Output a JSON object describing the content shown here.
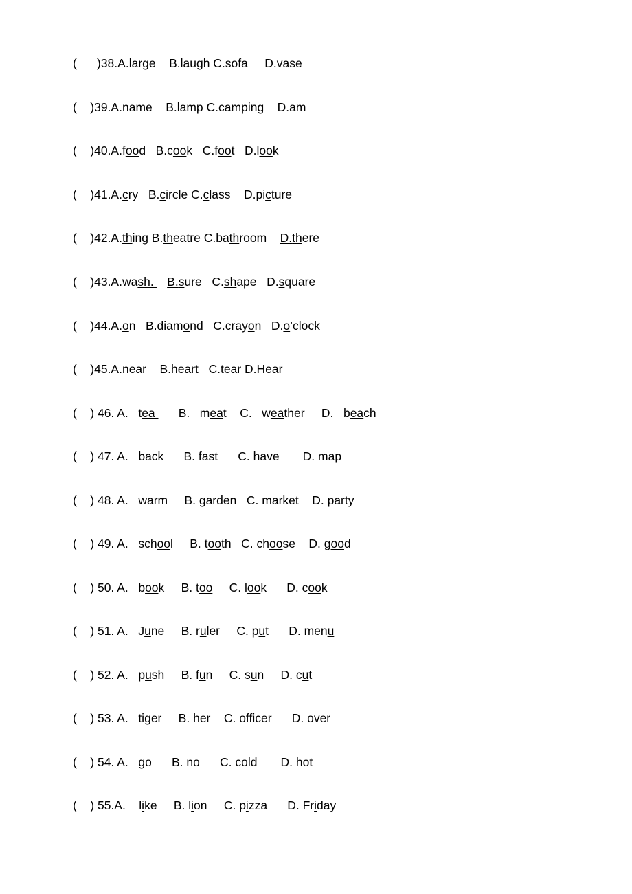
{
  "document": {
    "type": "worksheet",
    "section_title": "",
    "page_background": "#ffffff",
    "text_color": "#000000"
  },
  "questions": [
    {
      "number": "38",
      "bracket": "(",
      "bracket_close": ")",
      "gap": "      ",
      "prefix": ")38.A.",
      "separator": "compact",
      "options": [
        {
          "letter": "",
          "pre": "l",
          "mark": "ar",
          "post": "ge",
          "trail": "",
          "lead": ""
        },
        {
          "letter": "B.",
          "pre": "l",
          "mark": "au",
          "post": "gh",
          "trail": "",
          "lead": "    "
        },
        {
          "letter": "C.",
          "pre": "sof",
          "mark": "a ",
          "post": "",
          "trail": "",
          "lead": " "
        },
        {
          "letter": "D.",
          "pre": "v",
          "mark": "a",
          "post": "se",
          "trail": "",
          "lead": "    "
        }
      ]
    },
    {
      "number": "39",
      "prefix": ")39.A.",
      "options": [
        {
          "letter": "",
          "pre": "n",
          "mark": "a",
          "post": "me",
          "lead": ""
        },
        {
          "letter": "B.",
          "pre": "l",
          "mark": "a",
          "post": "mp",
          "lead": "    "
        },
        {
          "letter": "C.",
          "pre": "c",
          "mark": "a",
          "post": "mping",
          "lead": " "
        },
        {
          "letter": "D.",
          "pre": "",
          "mark": "a",
          "post": "m",
          "lead": "    "
        }
      ]
    },
    {
      "number": "40",
      "prefix": ")40.A.",
      "options": [
        {
          "letter": "",
          "pre": "f",
          "mark": "oo",
          "post": "d",
          "lead": ""
        },
        {
          "letter": "B.",
          "pre": "c",
          "mark": "oo",
          "post": "k",
          "lead": "   "
        },
        {
          "letter": "C.",
          "pre": "f",
          "mark": "oo",
          "post": "t",
          "lead": "   "
        },
        {
          "letter": "D.",
          "pre": "l",
          "mark": "oo",
          "post": "k",
          "lead": "   "
        }
      ]
    },
    {
      "number": "41",
      "prefix": ")41.A.",
      "options": [
        {
          "letter": "",
          "pre": "",
          "mark": "c",
          "post": "ry",
          "lead": ""
        },
        {
          "letter": "B.",
          "pre": "",
          "mark": "c",
          "post": "ircle",
          "lead": "   "
        },
        {
          "letter": "C.",
          "pre": "",
          "mark": "c",
          "post": "lass",
          "lead": " "
        },
        {
          "letter": "D.",
          "pre": "pi",
          "mark": "c",
          "post": "ture",
          "lead": "    "
        }
      ]
    },
    {
      "number": "42",
      "prefix": ")42.A.",
      "options": [
        {
          "letter": "",
          "pre": "",
          "mark": "th",
          "post": "ing",
          "lead": ""
        },
        {
          "letter": "B.",
          "pre": "",
          "mark": "th",
          "post": "eatre",
          "lead": " "
        },
        {
          "letter": "C.",
          "pre": "ba",
          "mark": "th",
          "post": "room",
          "lead": " "
        },
        {
          "letter": "D.",
          "pre": "",
          "mark": "th",
          "post": "ere",
          "lead": "    ",
          "letter_underlined": true
        }
      ]
    },
    {
      "number": "43",
      "prefix": ")43.A.",
      "options": [
        {
          "letter": "",
          "pre": "wa",
          "mark": "sh. ",
          "post": "",
          "lead": ""
        },
        {
          "letter": "B.",
          "pre": "",
          "mark": "s",
          "post": "ure",
          "lead": "   ",
          "letter_underlined": true
        },
        {
          "letter": "C.",
          "pre": "",
          "mark": "sh",
          "post": "ape",
          "lead": "   "
        },
        {
          "letter": "D.",
          "pre": "",
          "mark": "s",
          "post": "quare",
          "lead": "   "
        }
      ]
    },
    {
      "number": "44",
      "prefix": ")44.A.",
      "options": [
        {
          "letter": "",
          "pre": "",
          "mark": "o",
          "post": "n",
          "lead": ""
        },
        {
          "letter": "B.",
          "pre": "diam",
          "mark": "o",
          "post": "nd",
          "lead": "   "
        },
        {
          "letter": "C.",
          "pre": "cray",
          "mark": "o",
          "post": "n",
          "lead": "   "
        },
        {
          "letter": "D.",
          "pre": "",
          "mark": "o",
          "post": "’clock",
          "lead": "   "
        }
      ]
    },
    {
      "number": "45",
      "prefix": ")45.A.",
      "options": [
        {
          "letter": "",
          "pre": "n",
          "mark": "ear ",
          "post": "",
          "lead": ""
        },
        {
          "letter": "B.",
          "pre": "h",
          "mark": "ear",
          "post": "t",
          "lead": "   "
        },
        {
          "letter": "C.",
          "pre": "t",
          "mark": "ear",
          "post": "",
          "lead": "   "
        },
        {
          "letter": "D.",
          "pre": "H",
          "mark": "ear",
          "post": "",
          "lead": " "
        }
      ]
    },
    {
      "number": "46",
      "prefix": ") 46. A.",
      "separator": "spaced",
      "options": [
        {
          "letter": "",
          "pre": "t",
          "mark": "ea ",
          "post": "",
          "lead": "   "
        },
        {
          "letter": "B.",
          "pre": "m",
          "mark": "ea",
          "post": "t",
          "lead": "      ",
          "letter_gap": "   "
        },
        {
          "letter": "C.",
          "pre": "w",
          "mark": "ea",
          "post": "ther",
          "lead": "    ",
          "letter_gap": "   "
        },
        {
          "letter": "D.",
          "pre": "b",
          "mark": "ea",
          "post": "ch",
          "lead": "     ",
          "letter_gap": "   "
        }
      ]
    },
    {
      "number": "47",
      "prefix": ") 47. A.",
      "options": [
        {
          "letter": "",
          "pre": "b",
          "mark": "a",
          "post": "ck",
          "lead": "   "
        },
        {
          "letter": "B.",
          "pre": "f",
          "mark": "a",
          "post": "st",
          "lead": "      ",
          "letter_gap": " "
        },
        {
          "letter": "C.",
          "pre": "h",
          "mark": "a",
          "post": "ve",
          "lead": "      ",
          "letter_gap": " "
        },
        {
          "letter": "D.",
          "pre": "m",
          "mark": "a",
          "post": "p",
          "lead": "       ",
          "letter_gap": " "
        }
      ]
    },
    {
      "number": "48",
      "prefix": ") 48. A.",
      "options": [
        {
          "letter": "",
          "pre": "w",
          "mark": "ar",
          "post": "m",
          "lead": "   "
        },
        {
          "letter": "B.",
          "pre": "g",
          "mark": "ar",
          "post": "den",
          "lead": "     ",
          "letter_gap": " "
        },
        {
          "letter": "C.",
          "pre": "m",
          "mark": "ar",
          "post": "ket",
          "lead": "   ",
          "letter_gap": " "
        },
        {
          "letter": "D.",
          "pre": "p",
          "mark": "ar",
          "post": "ty",
          "lead": "    ",
          "letter_gap": " "
        }
      ]
    },
    {
      "number": "49",
      "prefix": ") 49. A.",
      "options": [
        {
          "letter": "",
          "pre": "sch",
          "mark": "oo",
          "post": "l",
          "lead": "   "
        },
        {
          "letter": "B.",
          "pre": "t",
          "mark": "oo",
          "post": "th",
          "lead": "     ",
          "letter_gap": " "
        },
        {
          "letter": "C.",
          "pre": "ch",
          "mark": "oo",
          "post": "se",
          "lead": "   ",
          "letter_gap": " "
        },
        {
          "letter": "D.",
          "pre": "g",
          "mark": "oo",
          "post": "d",
          "lead": "    ",
          "letter_gap": " "
        }
      ]
    },
    {
      "number": "50",
      "prefix": ") 50. A.",
      "options": [
        {
          "letter": "",
          "pre": "b",
          "mark": "oo",
          "post": "k",
          "lead": "   "
        },
        {
          "letter": "B.",
          "pre": "t",
          "mark": "oo",
          "post": "",
          "lead": "     ",
          "letter_gap": " "
        },
        {
          "letter": "C.",
          "pre": "l",
          "mark": "oo",
          "post": "k",
          "lead": "     ",
          "letter_gap": " "
        },
        {
          "letter": "D.",
          "pre": "c",
          "mark": "oo",
          "post": "k",
          "lead": "      ",
          "letter_gap": " "
        }
      ]
    },
    {
      "number": "51",
      "prefix": ") 51. A.",
      "options": [
        {
          "letter": "",
          "pre": "J",
          "mark": "u",
          "post": "ne",
          "lead": "   "
        },
        {
          "letter": "B.",
          "pre": "r",
          "mark": "u",
          "post": "ler",
          "lead": "     ",
          "letter_gap": " "
        },
        {
          "letter": "C.",
          "pre": "p",
          "mark": "u",
          "post": "t",
          "lead": "     ",
          "letter_gap": " "
        },
        {
          "letter": "D.",
          "pre": "men",
          "mark": "u",
          "post": "",
          "lead": "      ",
          "letter_gap": " "
        }
      ]
    },
    {
      "number": "52",
      "prefix": ") 52. A.",
      "options": [
        {
          "letter": "",
          "pre": "p",
          "mark": "u",
          "post": "sh",
          "lead": "   "
        },
        {
          "letter": "B.",
          "pre": "f",
          "mark": "u",
          "post": "n",
          "lead": "     ",
          "letter_gap": " "
        },
        {
          "letter": "C.",
          "pre": "s",
          "mark": "u",
          "post": "n",
          "lead": "     ",
          "letter_gap": " "
        },
        {
          "letter": "D.",
          "pre": "c",
          "mark": "u",
          "post": "t",
          "lead": "     ",
          "letter_gap": " "
        }
      ]
    },
    {
      "number": "53",
      "prefix": ") 53. A.",
      "options": [
        {
          "letter": "",
          "pre": "tig",
          "mark": "er",
          "post": "",
          "lead": "   "
        },
        {
          "letter": "B.",
          "pre": "h",
          "mark": "er",
          "post": "",
          "lead": "     ",
          "letter_gap": " "
        },
        {
          "letter": "C.",
          "pre": "offic",
          "mark": "er",
          "post": "",
          "lead": "    ",
          "letter_gap": " "
        },
        {
          "letter": "D.",
          "pre": "ov",
          "mark": "er",
          "post": "",
          "lead": "      ",
          "letter_gap": " "
        }
      ]
    },
    {
      "number": "54",
      "prefix": ") 54. A.",
      "options": [
        {
          "letter": "",
          "pre": "g",
          "mark": "o",
          "post": "",
          "lead": "   "
        },
        {
          "letter": "B.",
          "pre": "n",
          "mark": "o",
          "post": "",
          "lead": "      ",
          "letter_gap": " "
        },
        {
          "letter": "C.",
          "pre": "c",
          "mark": "o",
          "post": "ld",
          "lead": "      ",
          "letter_gap": " "
        },
        {
          "letter": "D.",
          "pre": "h",
          "mark": "o",
          "post": "t",
          "lead": "       ",
          "letter_gap": " "
        }
      ]
    },
    {
      "number": "55",
      "prefix": ") 55.A.",
      "options": [
        {
          "letter": "",
          "pre": "l",
          "mark": "i",
          "post": "ke",
          "lead": "    "
        },
        {
          "letter": "B.",
          "pre": "l",
          "mark": "i",
          "post": "on",
          "lead": "     ",
          "letter_gap": " "
        },
        {
          "letter": "C.",
          "pre": "p",
          "mark": "i",
          "post": "zza",
          "lead": "     ",
          "letter_gap": " "
        },
        {
          "letter": "D.",
          "pre": "Fr",
          "mark": "i",
          "post": "day",
          "lead": "      ",
          "letter_gap": " "
        }
      ]
    }
  ]
}
